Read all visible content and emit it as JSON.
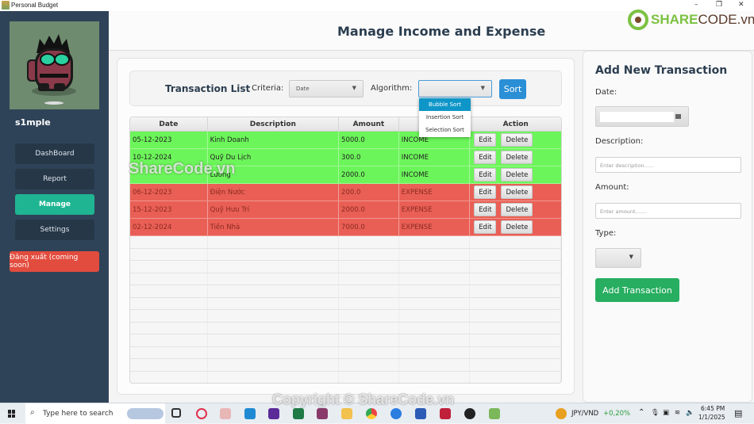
{
  "window": {
    "title": "Personal Budget",
    "controls": {
      "minimize": "–",
      "maximize": "❐",
      "close": "✕"
    }
  },
  "sidebar": {
    "username": "s1mple",
    "items": [
      {
        "label": "DashBoard",
        "active": false
      },
      {
        "label": "Report",
        "active": false
      },
      {
        "label": "Manage",
        "active": true
      },
      {
        "label": "Settings",
        "active": false
      }
    ],
    "logout_label": "Đăng xuất (coming soon)"
  },
  "header": {
    "title": "Manage Income and Expense",
    "logo_text_green": "SHARE",
    "logo_text_brown": "CODE.vn"
  },
  "toolbar": {
    "title": "Transaction List",
    "criteria_label": "Criteria:",
    "criteria_value": "Date",
    "algorithm_label": "Algorithm:",
    "algorithm_value": "",
    "algorithm_options": [
      "Bubble Sort",
      "Insertion Sort",
      "Selection Sort"
    ],
    "algorithm_highlighted": "Bubble Sort",
    "sort_label": "Sort"
  },
  "table": {
    "columns": [
      "Date",
      "Description",
      "Amount",
      "",
      "Action"
    ],
    "rows": [
      {
        "date": "05-12-2023",
        "description": "Kinh Doanh",
        "amount": "5000.0",
        "type": "INCOME"
      },
      {
        "date": "10-12-2024",
        "description": "Quỹ Du Lịch",
        "amount": "300.0",
        "type": "INCOME"
      },
      {
        "date": "",
        "description": "Lương",
        "amount": "2000.0",
        "type": "INCOME"
      },
      {
        "date": "06-12-2023",
        "description": "Điện Nước",
        "amount": "200.0",
        "type": "EXPENSE"
      },
      {
        "date": "15-12-2023",
        "description": "Quỹ Hưu Trí",
        "amount": "2000.0",
        "type": "EXPENSE"
      },
      {
        "date": "02-12-2024",
        "description": "Tiền Nhà",
        "amount": "7000.0",
        "type": "EXPENSE"
      }
    ],
    "edit_label": "Edit",
    "delete_label": "Delete"
  },
  "form": {
    "title": "Add New Transaction",
    "date_label": "Date:",
    "date_value": "",
    "description_label": "Description:",
    "description_placeholder": "Enter description......",
    "amount_label": "Amount:",
    "amount_placeholder": "Enter amount.......",
    "type_label": "Type:",
    "type_value": "",
    "submit_label": "Add Transaction"
  },
  "watermarks": {
    "center": "ShareCode.vn",
    "bottom": "Copyright © ShareCode.vn"
  },
  "taskbar": {
    "search_placeholder": "Type here to search",
    "ticker_name": "JPY/VND",
    "ticker_change": "+0,20%",
    "time": "6:45 PM",
    "date": "1/1/2025"
  },
  "colors": {
    "sidebar_bg": "#2f4358",
    "nav_active": "#1fb592",
    "logout": "#e24c3e",
    "income_row": "#6cf55a",
    "expense_row": "#e95f55",
    "sort_button": "#2b8fd6",
    "add_button": "#27ae60",
    "ticker_positive": "#2e9e3a"
  }
}
